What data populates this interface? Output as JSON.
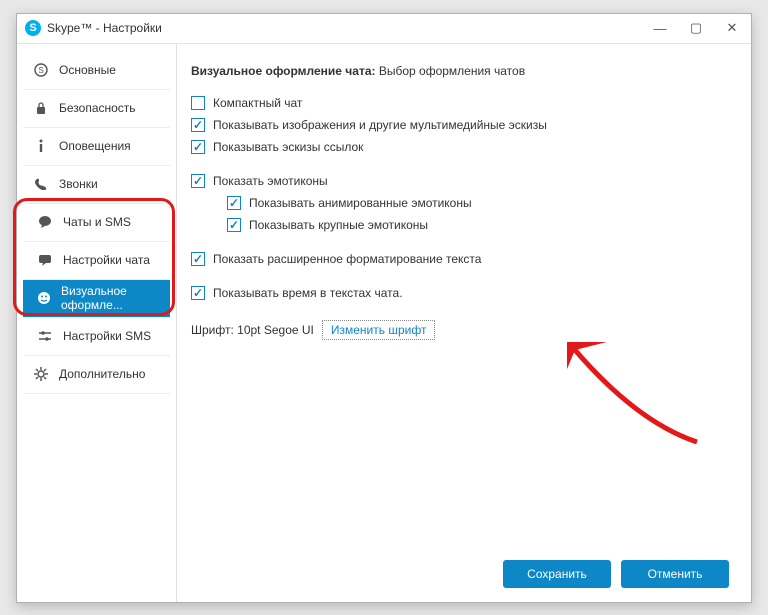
{
  "window": {
    "title": "Skype™ - Настройки"
  },
  "sidebar": {
    "items": [
      {
        "label": "Основные"
      },
      {
        "label": "Безопасность"
      },
      {
        "label": "Оповещения"
      },
      {
        "label": "Звонки"
      },
      {
        "label": "Чаты и SMS"
      },
      {
        "label": "Настройки чата"
      },
      {
        "label": "Визуальное оформле..."
      },
      {
        "label": "Настройки SMS"
      },
      {
        "label": "Дополнительно"
      }
    ]
  },
  "header": {
    "title": "Визуальное оформление чата:",
    "subtitle": "Выбор оформления чатов"
  },
  "options": {
    "compact": "Компактный чат",
    "show_images": "Показывать изображения и другие мультимедийные эскизы",
    "show_link_thumbs": "Показывать эскизы ссылок",
    "show_emoticons": "Показать эмотиконы",
    "show_animated": "Показывать анимированные эмотиконы",
    "show_large": "Показывать крупные эмотиконы",
    "show_formatting": "Показать расширенное форматирование текста",
    "show_time": "Показывать время в текстах чата."
  },
  "font": {
    "label": "Шрифт: 10pt Segoe UI",
    "change": "Изменить шрифт"
  },
  "buttons": {
    "save": "Сохранить",
    "cancel": "Отменить"
  }
}
